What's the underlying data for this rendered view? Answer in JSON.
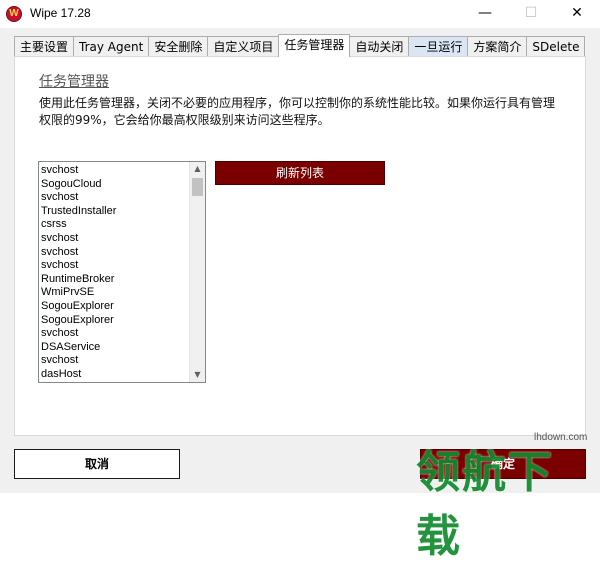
{
  "window": {
    "title": "Wipe 17.28",
    "app_icon_glyph": "W",
    "controls": {
      "minimize": "—",
      "maximize": "☐",
      "close": "✕"
    }
  },
  "tabs": [
    {
      "label": "主要设置",
      "active": false
    },
    {
      "label": "Tray Agent",
      "active": false
    },
    {
      "label": "安全删除",
      "active": false
    },
    {
      "label": "自定义项目",
      "active": false
    },
    {
      "label": "任务管理器",
      "active": true
    },
    {
      "label": "自动关闭",
      "active": false
    },
    {
      "label": "一旦运行",
      "active": false
    },
    {
      "label": "方案简介",
      "active": false
    },
    {
      "label": "SDelete",
      "active": false
    }
  ],
  "panel": {
    "title": "任务管理器",
    "description": "使用此任务管理器，关闭不必要的应用程序，你可以控制你的系统性能比较。如果你运行具有管理权限的99%，它会给你最高权限级别来访问这些程序。",
    "refresh_label": "刷新列表",
    "processes": [
      "svchost",
      "SogouCloud",
      "svchost",
      "TrustedInstaller",
      "csrss",
      "svchost",
      "svchost",
      "svchost",
      "RuntimeBroker",
      "WmiPrvSE",
      "SogouExplorer",
      "SogouExplorer",
      "svchost",
      "DSAService",
      "svchost",
      "dasHost"
    ]
  },
  "footer": {
    "cancel_label": "取消",
    "ok_label": "确定"
  },
  "watermark": {
    "text": "领航下载",
    "url": "lhdown.com"
  },
  "colors": {
    "accent": "#7a0000",
    "tab_highlight": "#dbe6f5",
    "watermark": "#118a2d"
  }
}
